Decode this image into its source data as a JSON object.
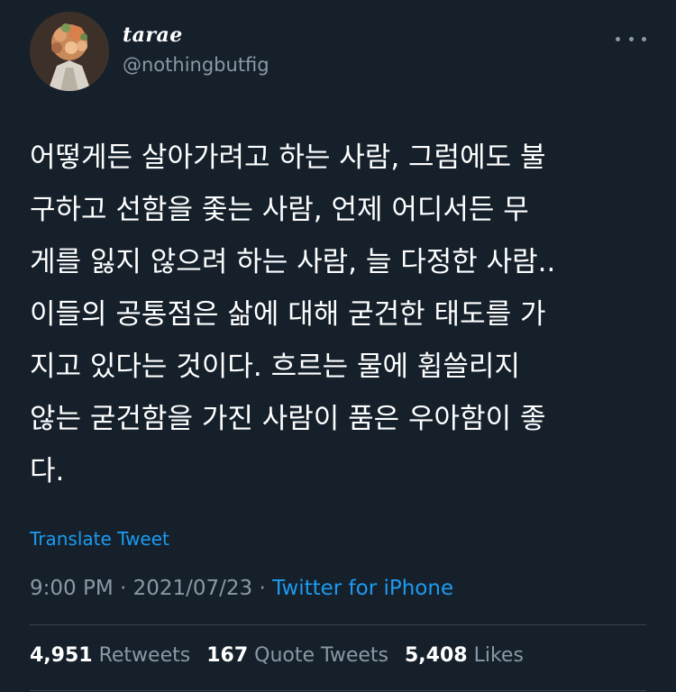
{
  "user": {
    "display_name": "tarae",
    "handle": "@nothingbutfig"
  },
  "more_icon": "more-horizontal-icon",
  "tweet": {
    "lines": [
      "어떻게든 살아가려고 하는 사람, 그럼에도 불",
      "구하고 선함을 좇는 사람, 언제 어디서든 무",
      "게를 잃지 않으려 하는 사람, 늘 다정한 사람..",
      "이들의 공통점은 삶에 대해 굳건한 태도를 가",
      "지고 있다는 것이다. 흐르는 물에 휩쓸리지",
      "않는 굳건함을 가진 사람이 품은 우아함이 좋",
      "다."
    ],
    "translate_label": "Translate Tweet",
    "time": "9:00 PM",
    "date": "2021/07/23",
    "separator": "·",
    "source": "Twitter for iPhone"
  },
  "stats": {
    "retweets_count": "4,951",
    "retweets_label": "Retweets",
    "quotes_count": "167",
    "quotes_label": "Quote Tweets",
    "likes_count": "5,408",
    "likes_label": "Likes"
  },
  "colors": {
    "background": "#15202b",
    "text": "#ffffff",
    "secondary": "#8b98a5",
    "link": "#1d9bf0",
    "divider": "#38444d"
  }
}
